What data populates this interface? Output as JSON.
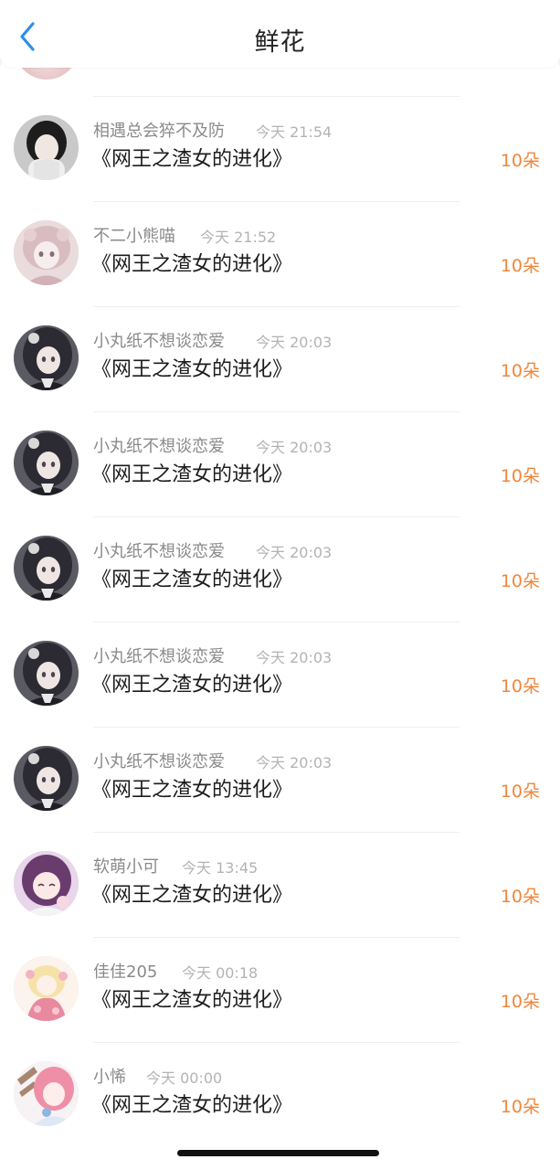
{
  "header": {
    "title": "鲜花"
  },
  "colors": {
    "amount": "#f0863a",
    "back_icon": "#2f8ee8"
  },
  "items": [
    {
      "name": "相遇总会猝不及防",
      "time": "今天 21:54",
      "book": "《网王之渣女的进化》",
      "amount": "10朵",
      "avatar": "girl-dark-hair-avatar"
    },
    {
      "name": "不二小熊喵",
      "time": "今天 21:52",
      "book": "《网王之渣女的进化》",
      "amount": "10朵",
      "avatar": "pink-hair-girl-avatar"
    },
    {
      "name": "小丸纸不想谈恋爱",
      "time": "今天 20:03",
      "book": "《网王之渣女的进化》",
      "amount": "10朵",
      "avatar": "anime-girl-avatar"
    },
    {
      "name": "小丸纸不想谈恋爱",
      "time": "今天 20:03",
      "book": "《网王之渣女的进化》",
      "amount": "10朵",
      "avatar": "anime-girl-avatar"
    },
    {
      "name": "小丸纸不想谈恋爱",
      "time": "今天 20:03",
      "book": "《网王之渣女的进化》",
      "amount": "10朵",
      "avatar": "anime-girl-avatar"
    },
    {
      "name": "小丸纸不想谈恋爱",
      "time": "今天 20:03",
      "book": "《网王之渣女的进化》",
      "amount": "10朵",
      "avatar": "anime-girl-avatar"
    },
    {
      "name": "小丸纸不想谈恋爱",
      "time": "今天 20:03",
      "book": "《网王之渣女的进化》",
      "amount": "10朵",
      "avatar": "anime-girl-avatar"
    },
    {
      "name": "软萌小可",
      "time": "今天 13:45",
      "book": "《网王之渣女的进化》",
      "amount": "10朵",
      "avatar": "purple-hair-girl-avatar"
    },
    {
      "name": "佳佳205",
      "time": "今天 00:18",
      "book": "《网王之渣女的进化》",
      "amount": "10朵",
      "avatar": "flower-girl-avatar"
    },
    {
      "name": "小悕",
      "time": "今天 00:00",
      "book": "《网王之渣女的进化》",
      "amount": "10朵",
      "avatar": "pink-girl-avatar"
    }
  ]
}
